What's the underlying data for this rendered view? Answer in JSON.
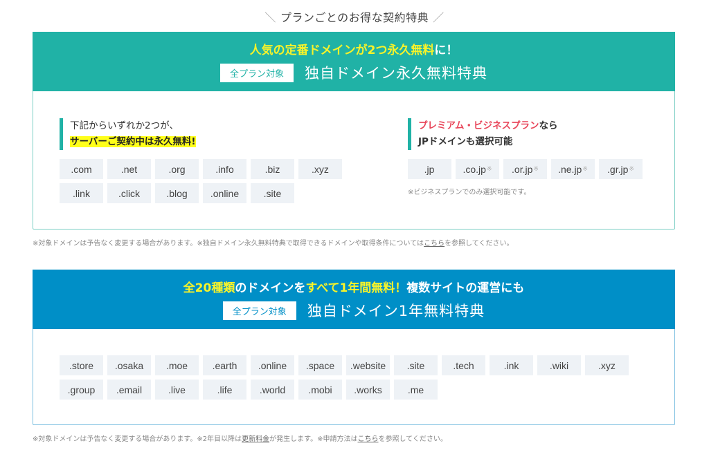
{
  "section_heading": {
    "slash_left": "＼",
    "text": "プランごとのお得な契約特典",
    "slash_right": "／"
  },
  "colors": {
    "teal": "#20b2a6",
    "blue": "#008fc7",
    "highlight_yellow": "#f7f32a",
    "marker_yellow": "#ffff1a",
    "red": "#e8465a",
    "chip_bg": "#eef2f6"
  },
  "card_permanent": {
    "headline": {
      "part1_highlight": "人気の定番ドメイン",
      "part2": "が",
      "part3_highlight": "2つ永久無料",
      "part4": "に！"
    },
    "badge": "全プラン対象",
    "title": "独自ドメイン永久無料特典",
    "left_note": {
      "line1": "下記からいずれか2つが、",
      "line2": "サーバーご契約中は永久無料!"
    },
    "left_domains": [
      ".com",
      ".net",
      ".org",
      ".info",
      ".biz",
      ".xyz",
      ".link",
      ".click",
      ".blog",
      ".online",
      ".site"
    ],
    "right_note": {
      "line1_red": "プレミアム・ビジネスプラン",
      "line1_rest": "なら",
      "line2": "JPドメインも選択可能"
    },
    "right_domains": [
      {
        "name": ".jp",
        "asterisk": ""
      },
      {
        "name": ".co.jp",
        "asterisk": "※"
      },
      {
        "name": ".or.jp",
        "asterisk": "※"
      },
      {
        "name": ".ne.jp",
        "asterisk": "※"
      },
      {
        "name": ".gr.jp",
        "asterisk": "※"
      }
    ],
    "right_subnote": "※ビジネスプランでのみ選択可能です。"
  },
  "footnote1": {
    "text_before": "※対象ドメインは予告なく変更する場合があります。※独自ドメイン永久無料特典で取得できるドメインや取得条件については",
    "link": "こちら",
    "text_after": "を参照してください。"
  },
  "card_oneyear": {
    "headline": {
      "part1_highlight": "全20種類",
      "part2": "のドメインを",
      "part3_highlight": "すべて1年間無料！",
      "part4": "複数サイトの運営にも"
    },
    "badge": "全プラン対象",
    "title": "独自ドメイン1年無料特典",
    "domains": [
      ".store",
      ".osaka",
      ".moe",
      ".earth",
      ".online",
      ".space",
      ".website",
      ".site",
      ".tech",
      ".ink",
      ".wiki",
      ".xyz",
      ".group",
      ".email",
      ".live",
      ".life",
      ".world",
      ".mobi",
      ".works",
      ".me"
    ]
  },
  "footnote2": {
    "text1": "※対象ドメインは予告なく変更する場合があります。※2年目以降は",
    "link1": "更新料金",
    "text2": "が発生します。※申請方法は",
    "link2": "こちら",
    "text3": "を参照してください。"
  }
}
